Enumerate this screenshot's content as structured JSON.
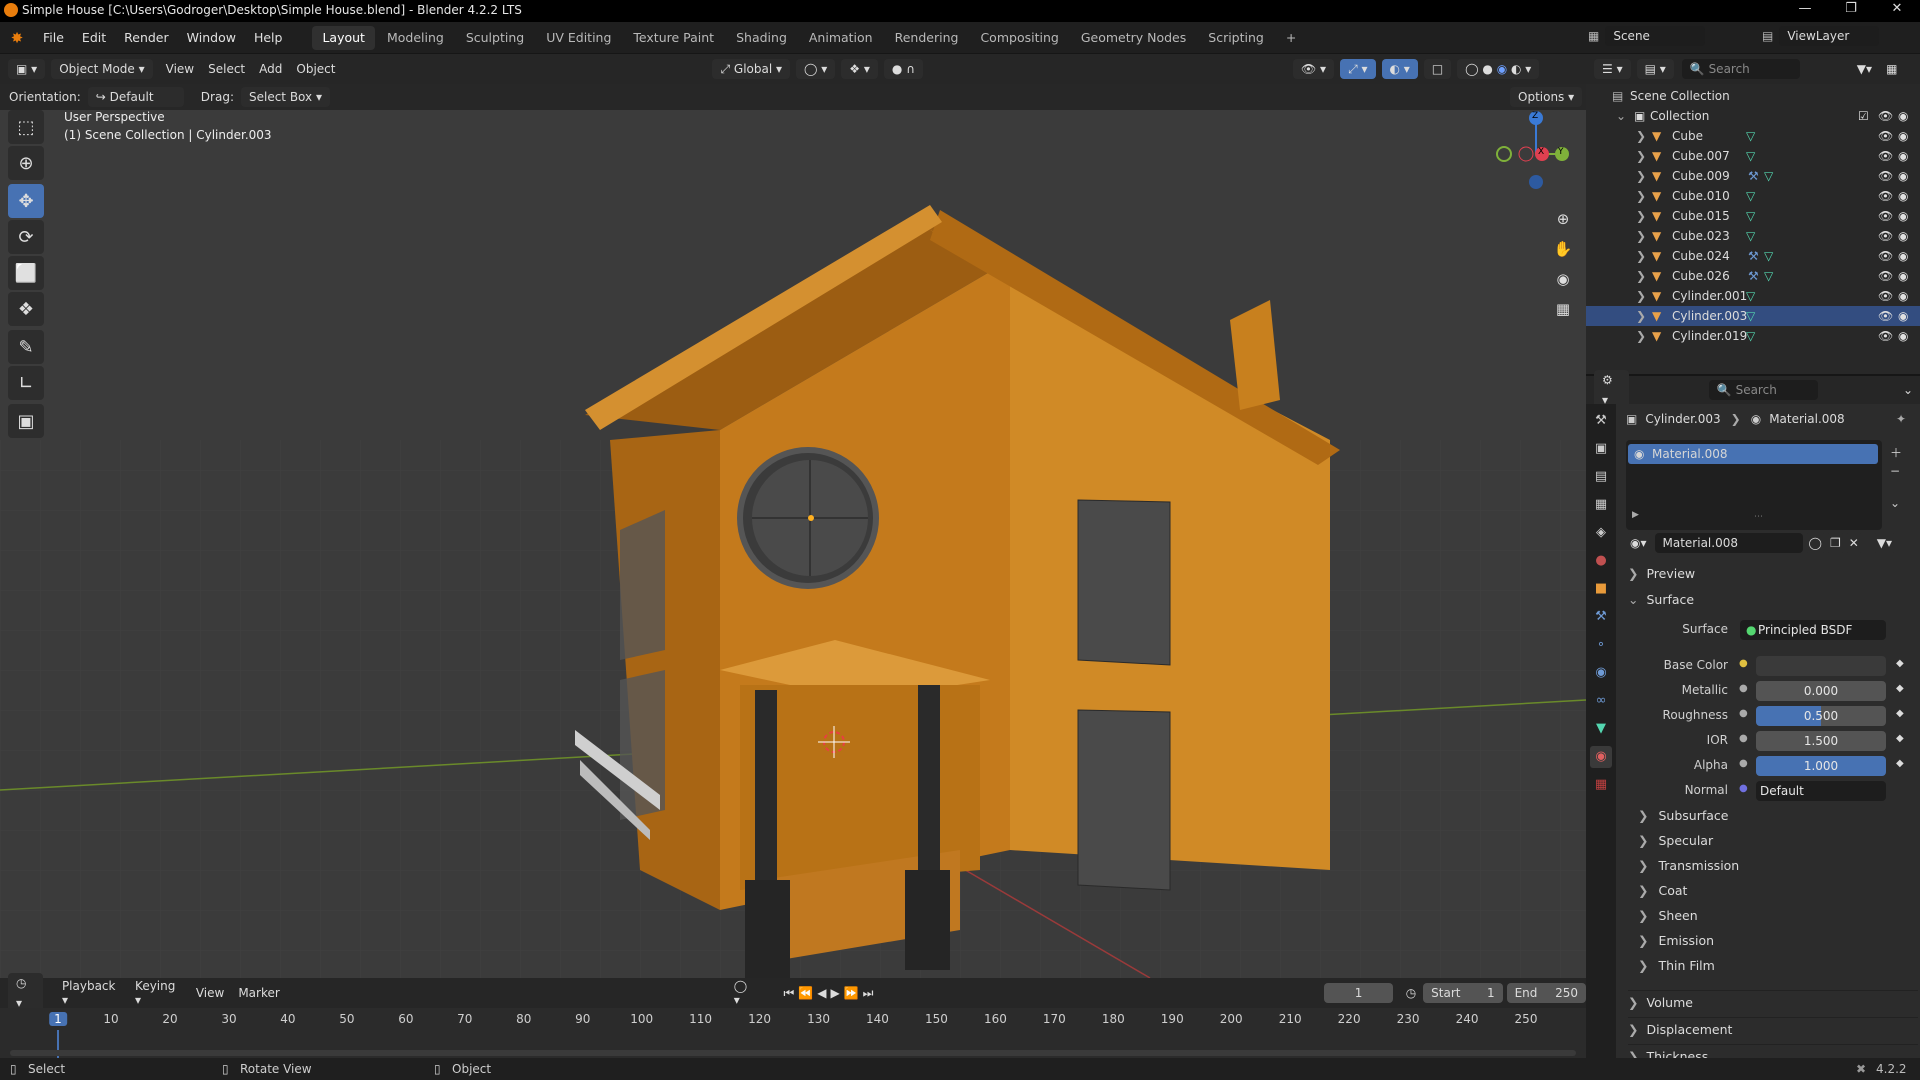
{
  "window": {
    "title": "Simple House [C:\\Users\\Godroger\\Desktop\\Simple House.blend] - Blender 4.2.2 LTS"
  },
  "menubar": {
    "menus": [
      "File",
      "Edit",
      "Render",
      "Window",
      "Help"
    ],
    "workspaces": [
      "Layout",
      "Modeling",
      "Sculpting",
      "UV Editing",
      "Texture Paint",
      "Shading",
      "Animation",
      "Rendering",
      "Compositing",
      "Geometry Nodes",
      "Scripting"
    ],
    "active_workspace": "Layout",
    "add_tab": "+",
    "scene": "Scene",
    "view_layer": "ViewLayer"
  },
  "viewport_header": {
    "mode": "Object Mode",
    "menus": [
      "View",
      "Select",
      "Add",
      "Object"
    ],
    "transform_orientation": "Global",
    "options_label": "Options"
  },
  "tool_header": {
    "orientation_label": "Orientation:",
    "orientation_value": "Default",
    "drag_label": "Drag:",
    "drag_value": "Select Box"
  },
  "viewport": {
    "view_name": "User Perspective",
    "context": "(1) Scene Collection | Cylinder.003",
    "gizmo_axes": [
      "Z",
      "X",
      "Y"
    ]
  },
  "outliner": {
    "search_placeholder": "Search",
    "scene_collection": "Scene Collection",
    "collection": "Collection",
    "items": [
      {
        "name": "Cube",
        "modifier": false
      },
      {
        "name": "Cube.007",
        "modifier": false
      },
      {
        "name": "Cube.009",
        "modifier": true
      },
      {
        "name": "Cube.010",
        "modifier": false
      },
      {
        "name": "Cube.015",
        "modifier": false
      },
      {
        "name": "Cube.023",
        "modifier": false
      },
      {
        "name": "Cube.024",
        "modifier": true
      },
      {
        "name": "Cube.026",
        "modifier": true
      },
      {
        "name": "Cylinder.001",
        "modifier": false
      },
      {
        "name": "Cylinder.003",
        "modifier": false,
        "active": true
      },
      {
        "name": "Cylinder.019",
        "modifier": false
      }
    ]
  },
  "properties": {
    "search_placeholder": "Search",
    "breadcrumb_object": "Cylinder.003",
    "breadcrumb_material": "Material.008",
    "slot_material": "Material.008",
    "material_name": "Material.008",
    "sections": {
      "preview": "Preview",
      "surface": "Surface"
    },
    "surface_label": "Surface",
    "surface_shader": "Principled BSDF",
    "fields": [
      {
        "label": "Base Color",
        "value": "",
        "kind": "color"
      },
      {
        "label": "Metallic",
        "value": "0.000",
        "kind": "num",
        "fill": 0.0
      },
      {
        "label": "Roughness",
        "value": "0.500",
        "kind": "num",
        "fill": 0.5
      },
      {
        "label": "IOR",
        "value": "1.500",
        "kind": "num",
        "fill": 0.0
      },
      {
        "label": "Alpha",
        "value": "1.000",
        "kind": "num",
        "fill": 1.0
      },
      {
        "label": "Normal",
        "value": "Default",
        "kind": "link"
      }
    ],
    "subsections": [
      "Subsurface",
      "Specular",
      "Transmission",
      "Coat",
      "Sheen",
      "Emission",
      "Thin Film"
    ],
    "bottom_sections": [
      "Volume",
      "Displacement",
      "Thickness"
    ]
  },
  "timeline": {
    "menus": [
      "Playback",
      "Keying",
      "View",
      "Marker"
    ],
    "current_frame": "1",
    "start_label": "Start",
    "start_value": "1",
    "end_label": "End",
    "end_value": "250",
    "ticks": [
      "1",
      "10",
      "20",
      "30",
      "40",
      "50",
      "60",
      "70",
      "80",
      "90",
      "100",
      "110",
      "120",
      "130",
      "140",
      "150",
      "160",
      "170",
      "180",
      "190",
      "200",
      "210",
      "220",
      "230",
      "240",
      "250"
    ]
  },
  "statusbar": {
    "select": "Select",
    "rotate": "Rotate View",
    "object": "Object",
    "version": "4.2.2"
  },
  "colors": {
    "accent": "#4772b3",
    "house": "#c8811f",
    "active_tab": "#303030"
  }
}
